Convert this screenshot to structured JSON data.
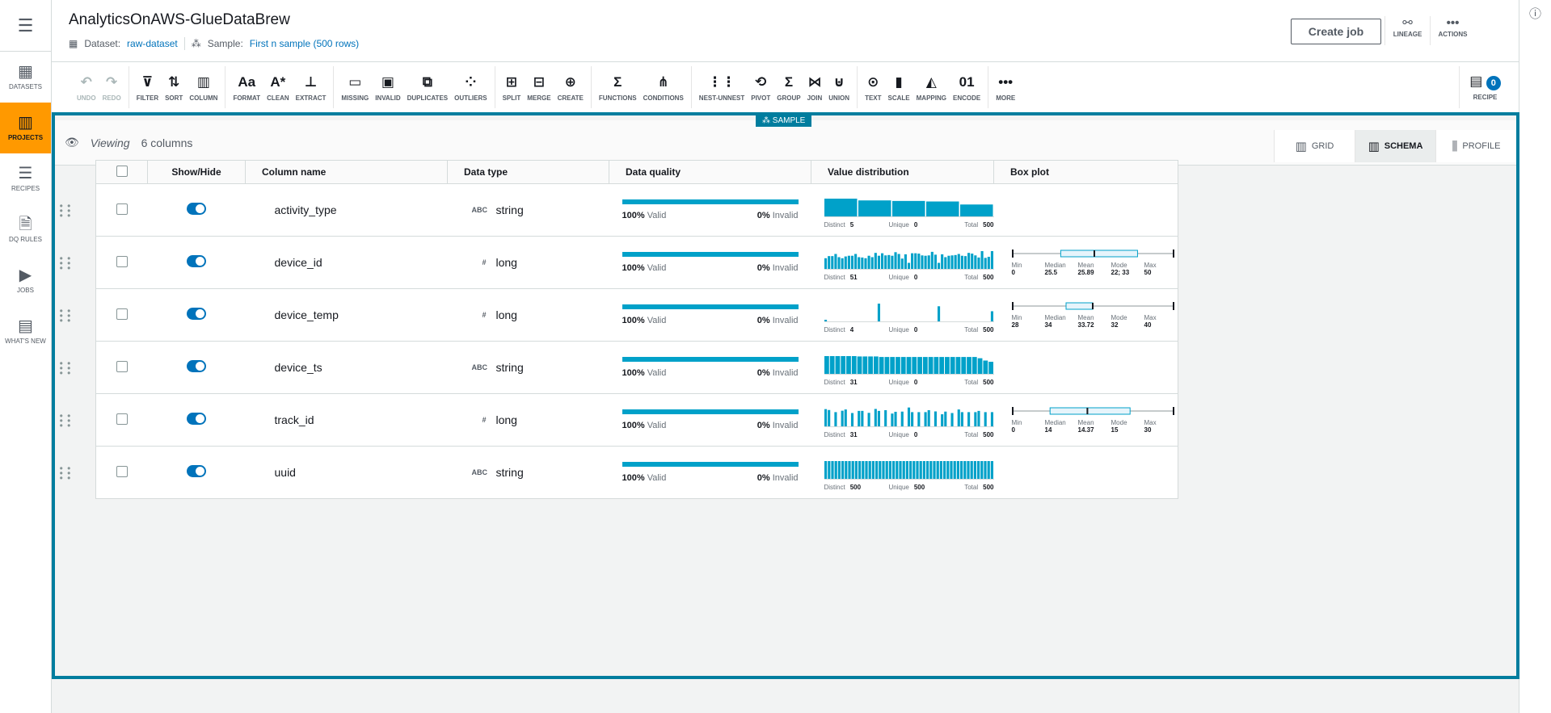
{
  "colors": {
    "accent": "#007d9e",
    "bar": "#00a1c9",
    "active_nav": "#ff9900",
    "link": "#0073bb"
  },
  "sidebar": {
    "menu_icon": "hamburger-icon",
    "items": [
      {
        "label": "DATASETS",
        "icon": "table-icon",
        "active": false
      },
      {
        "label": "PROJECTS",
        "icon": "grid-icon",
        "active": true
      },
      {
        "label": "RECIPES",
        "icon": "list-icon",
        "active": false
      },
      {
        "label": "DQ RULES",
        "icon": "certificate-icon",
        "active": false
      },
      {
        "label": "JOBS",
        "icon": "play-icon",
        "active": false
      },
      {
        "label": "WHAT'S NEW",
        "icon": "news-icon",
        "active": false
      }
    ]
  },
  "header": {
    "title": "AnalyticsOnAWS-GlueDataBrew",
    "dataset_label": "Dataset:",
    "dataset_value": "raw-dataset",
    "sample_label": "Sample:",
    "sample_value": "First n sample (500 rows)",
    "create_job": "Create job",
    "lineage": "LINEAGE",
    "actions": "ACTIONS"
  },
  "toolbar": {
    "groups": [
      [
        {
          "label": "UNDO",
          "icon": "undo-icon",
          "disabled": true
        },
        {
          "label": "REDO",
          "icon": "redo-icon",
          "disabled": true
        }
      ],
      [
        {
          "label": "FILTER",
          "icon": "filter-icon"
        },
        {
          "label": "SORT",
          "icon": "sort-icon"
        },
        {
          "label": "COLUMN",
          "icon": "column-icon"
        }
      ],
      [
        {
          "label": "FORMAT",
          "icon": "format-icon"
        },
        {
          "label": "CLEAN",
          "icon": "clean-icon"
        },
        {
          "label": "EXTRACT",
          "icon": "extract-icon"
        }
      ],
      [
        {
          "label": "MISSING",
          "icon": "missing-icon"
        },
        {
          "label": "INVALID",
          "icon": "invalid-icon"
        },
        {
          "label": "DUPLICATES",
          "icon": "duplicates-icon"
        },
        {
          "label": "OUTLIERS",
          "icon": "outliers-icon"
        }
      ],
      [
        {
          "label": "SPLIT",
          "icon": "split-icon"
        },
        {
          "label": "MERGE",
          "icon": "merge-icon"
        },
        {
          "label": "CREATE",
          "icon": "create-column-icon"
        }
      ],
      [
        {
          "label": "FUNCTIONS",
          "icon": "sigma-icon"
        },
        {
          "label": "CONDITIONS",
          "icon": "conditions-icon"
        }
      ],
      [
        {
          "label": "NEST-UNNEST",
          "icon": "nest-icon"
        },
        {
          "label": "PIVOT",
          "icon": "pivot-icon"
        },
        {
          "label": "GROUP",
          "icon": "group-icon"
        },
        {
          "label": "JOIN",
          "icon": "join-icon"
        },
        {
          "label": "UNION",
          "icon": "union-icon"
        }
      ],
      [
        {
          "label": "TEXT",
          "icon": "text-icon"
        },
        {
          "label": "SCALE",
          "icon": "scale-icon"
        },
        {
          "label": "MAPPING",
          "icon": "mapping-icon"
        },
        {
          "label": "ENCODE",
          "icon": "encode-icon"
        }
      ],
      [
        {
          "label": "MORE",
          "icon": "more-icon"
        }
      ]
    ],
    "recipe_label": "RECIPE",
    "recipe_count": "0"
  },
  "main": {
    "sample_badge": "SAMPLE",
    "viewing_label": "Viewing",
    "viewing_count": "6 columns",
    "tabs": [
      {
        "label": "GRID",
        "icon": "grid-icon",
        "active": false
      },
      {
        "label": "SCHEMA",
        "icon": "schema-icon",
        "active": true
      },
      {
        "label": "PROFILE",
        "icon": "profile-icon",
        "active": false
      }
    ],
    "headers": [
      "",
      "Show/Hide",
      "Column name",
      "Data type",
      "Data quality",
      "Value distribution",
      "Box plot"
    ],
    "stat_labels": {
      "distinct": "Distinct",
      "unique": "Unique",
      "total": "Total",
      "valid": "Valid",
      "invalid": "Invalid",
      "min": "Min",
      "median": "Median",
      "mean": "Mean",
      "mode": "Mode",
      "max": "Max"
    },
    "rows": [
      {
        "name": "activity_type",
        "type_icon": "ABC",
        "type": "string",
        "valid": "100%",
        "invalid": "0%",
        "valid_fraction": 1.0,
        "distinct": "5",
        "unique": "0",
        "total": "500",
        "hist": [
          100,
          90,
          87,
          84,
          67
        ],
        "hist_gap": true
      },
      {
        "name": "device_id",
        "type_icon": "#",
        "type": "long",
        "valid": "100%",
        "invalid": "0%",
        "valid_fraction": 1.0,
        "distinct": "51",
        "unique": "0",
        "total": "500",
        "hist": [
          60,
          72,
          72,
          84,
          66,
          60,
          70,
          74,
          74,
          84,
          66,
          64,
          60,
          74,
          66,
          90,
          74,
          88,
          76,
          78,
          74,
          94,
          84,
          58,
          82,
          34,
          88,
          88,
          86,
          76,
          74,
          76,
          96,
          80,
          34,
          82,
          66,
          74,
          76,
          78,
          84,
          74,
          72,
          90,
          86,
          76,
          64,
          100,
          62,
          68,
          100
        ],
        "box": {
          "min": "0",
          "median": "25.5",
          "mean": "25.89",
          "mode": "22; 33",
          "max": "50",
          "lo": 0,
          "hi": 50,
          "q1": 15,
          "q3": 39,
          "med": 25.5
        }
      },
      {
        "name": "device_temp",
        "type_icon": "#",
        "type": "long",
        "valid": "100%",
        "invalid": "0%",
        "valid_fraction": 1.0,
        "distinct": "4",
        "unique": "0",
        "total": "500",
        "hist": [
          7,
          0,
          0,
          0,
          0,
          0,
          0,
          0,
          0,
          0,
          0,
          0,
          0,
          0,
          0,
          0,
          100,
          0,
          0,
          0,
          0,
          0,
          0,
          0,
          0,
          0,
          0,
          0,
          0,
          0,
          0,
          0,
          0,
          0,
          85,
          0,
          0,
          0,
          0,
          0,
          0,
          0,
          0,
          0,
          0,
          0,
          0,
          0,
          0,
          0,
          57
        ],
        "box": {
          "min": "28",
          "median": "34",
          "mean": "33.72",
          "mode": "32",
          "max": "40",
          "lo": 28,
          "hi": 40,
          "q1": 32,
          "q3": 34,
          "med": 34
        }
      },
      {
        "name": "device_ts",
        "type_icon": "ABC",
        "type": "string",
        "valid": "100%",
        "invalid": "0%",
        "valid_fraction": 1.0,
        "distinct": "31",
        "unique": "0",
        "total": "500",
        "hist": [
          100,
          100,
          100,
          100,
          100,
          100,
          98,
          98,
          98,
          98,
          95,
          95,
          95,
          95,
          95,
          95,
          95,
          95,
          95,
          95,
          95,
          95,
          95,
          95,
          95,
          95,
          95,
          95,
          88,
          75,
          68
        ]
      },
      {
        "name": "track_id",
        "type_icon": "#",
        "type": "long",
        "valid": "100%",
        "invalid": "0%",
        "valid_fraction": 1.0,
        "distinct": "31",
        "unique": "0",
        "total": "500",
        "hist": [
          97,
          92,
          0,
          80,
          0,
          88,
          95,
          0,
          75,
          0,
          87,
          87,
          0,
          76,
          0,
          98,
          87,
          0,
          91,
          0,
          72,
          82,
          0,
          83,
          0,
          106,
          80,
          0,
          80,
          0,
          80,
          91,
          0,
          84,
          0,
          68,
          83,
          0,
          75,
          0,
          95,
          80,
          0,
          80,
          0,
          80,
          87,
          0,
          80,
          0,
          80
        ],
        "box": {
          "min": "0",
          "median": "14",
          "mean": "14.37",
          "mode": "15",
          "max": "30",
          "lo": 0,
          "hi": 30,
          "q1": 7,
          "q3": 22,
          "med": 14
        }
      },
      {
        "name": "uuid",
        "type_icon": "ABC",
        "type": "string",
        "valid": "100%",
        "invalid": "0%",
        "valid_fraction": 1.0,
        "distinct": "500",
        "unique": "500",
        "total": "500",
        "hist": [
          100,
          100,
          100,
          100,
          100,
          100,
          100,
          100,
          100,
          100,
          100,
          100,
          100,
          100,
          100,
          100,
          100,
          100,
          100,
          100,
          100,
          100,
          100,
          100,
          100,
          100,
          100,
          100,
          100,
          100,
          100,
          100,
          100,
          100,
          100,
          100,
          100,
          100,
          100,
          100,
          100,
          100,
          100,
          100,
          100,
          100,
          100,
          100,
          100,
          100
        ]
      }
    ]
  }
}
